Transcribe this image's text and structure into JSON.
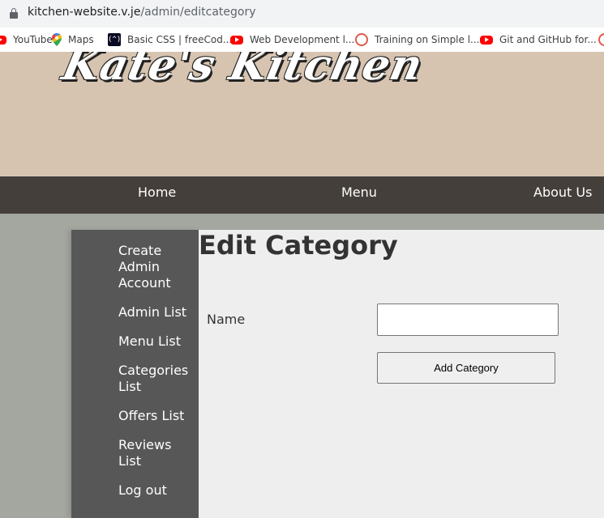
{
  "browser": {
    "url_host": "kitchen-website.v.je",
    "url_path": "/admin/editcategory",
    "bookmarks": [
      {
        "label": "YouTube",
        "icon": "youtube-icon"
      },
      {
        "label": "Maps",
        "icon": "google-maps-icon"
      },
      {
        "label": "Basic CSS | freeCod...",
        "icon": "freecodecamp-icon"
      },
      {
        "label": "Web Development l...",
        "icon": "youtube-icon"
      },
      {
        "label": "Training on Simple l...",
        "icon": "simplilearn-icon"
      },
      {
        "label": "Git and GitHub for...",
        "icon": "youtube-icon"
      }
    ]
  },
  "site": {
    "logo_text": "Kate's Kitchen",
    "nav": [
      "Home",
      "Menu",
      "About Us"
    ]
  },
  "sidebar": {
    "items": [
      "Create Admin Account",
      "Admin List",
      "Menu List",
      "Categories List",
      "Offers List",
      "Reviews List",
      "Log out"
    ]
  },
  "main": {
    "title": "Edit Category",
    "name_label": "Name",
    "name_value": "",
    "submit_label": "Add Category"
  },
  "colors": {
    "header_bg": "#d7c4b0",
    "nav_bg": "#443f3b",
    "sidebar_bg": "#575757",
    "page_bg": "#a4a7a0",
    "content_bg": "#eeeeee"
  }
}
